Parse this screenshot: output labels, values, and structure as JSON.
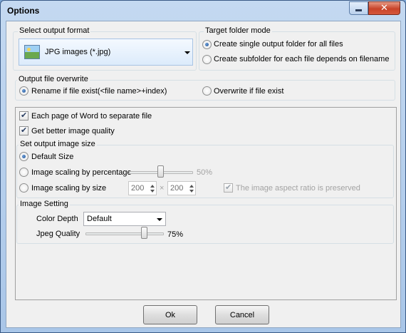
{
  "window": {
    "title": "Options",
    "minimize_icon": "minimize-icon",
    "close_icon": "close-icon",
    "close_color": "#c8442a"
  },
  "output_format": {
    "group_label": "Select output format",
    "selected": "JPG images (*.jpg)",
    "icon": "image-file-icon"
  },
  "target_folder": {
    "group_label": "Target folder mode",
    "options": [
      {
        "label": "Create single output folder for all files",
        "selected": true
      },
      {
        "label": "Create subfolder for each file depends on filename",
        "selected": false
      }
    ]
  },
  "overwrite": {
    "group_label": "Output file overwrite",
    "options": [
      {
        "label": "Rename if file exist(<file name>+index)",
        "selected": true
      },
      {
        "label": "Overwrite if file exist",
        "selected": false
      }
    ]
  },
  "checkboxes": [
    {
      "label": "Each page of Word to separate file",
      "checked": true
    },
    {
      "label": "Get better image quality",
      "checked": true
    }
  ],
  "image_size": {
    "group_label": "Set output image size",
    "default_label": "Default Size",
    "default_selected": true,
    "percentage_label": "Image scaling by percentage",
    "percentage_value": "50%",
    "percentage_level": 0.5,
    "size_label": "Image scaling by size",
    "width": "200",
    "height": "200",
    "separator": "×",
    "aspect_label": "The image aspect ratio is preserved",
    "aspect_checked": true
  },
  "image_setting": {
    "group_label": "Image Setting",
    "color_depth_label": "Color Depth",
    "color_depth_value": "Default",
    "jpeg_quality_label": "Jpeg Quality",
    "jpeg_quality_value": "75%",
    "jpeg_quality_level": 0.75
  },
  "buttons": {
    "ok": "Ok",
    "cancel": "Cancel"
  }
}
